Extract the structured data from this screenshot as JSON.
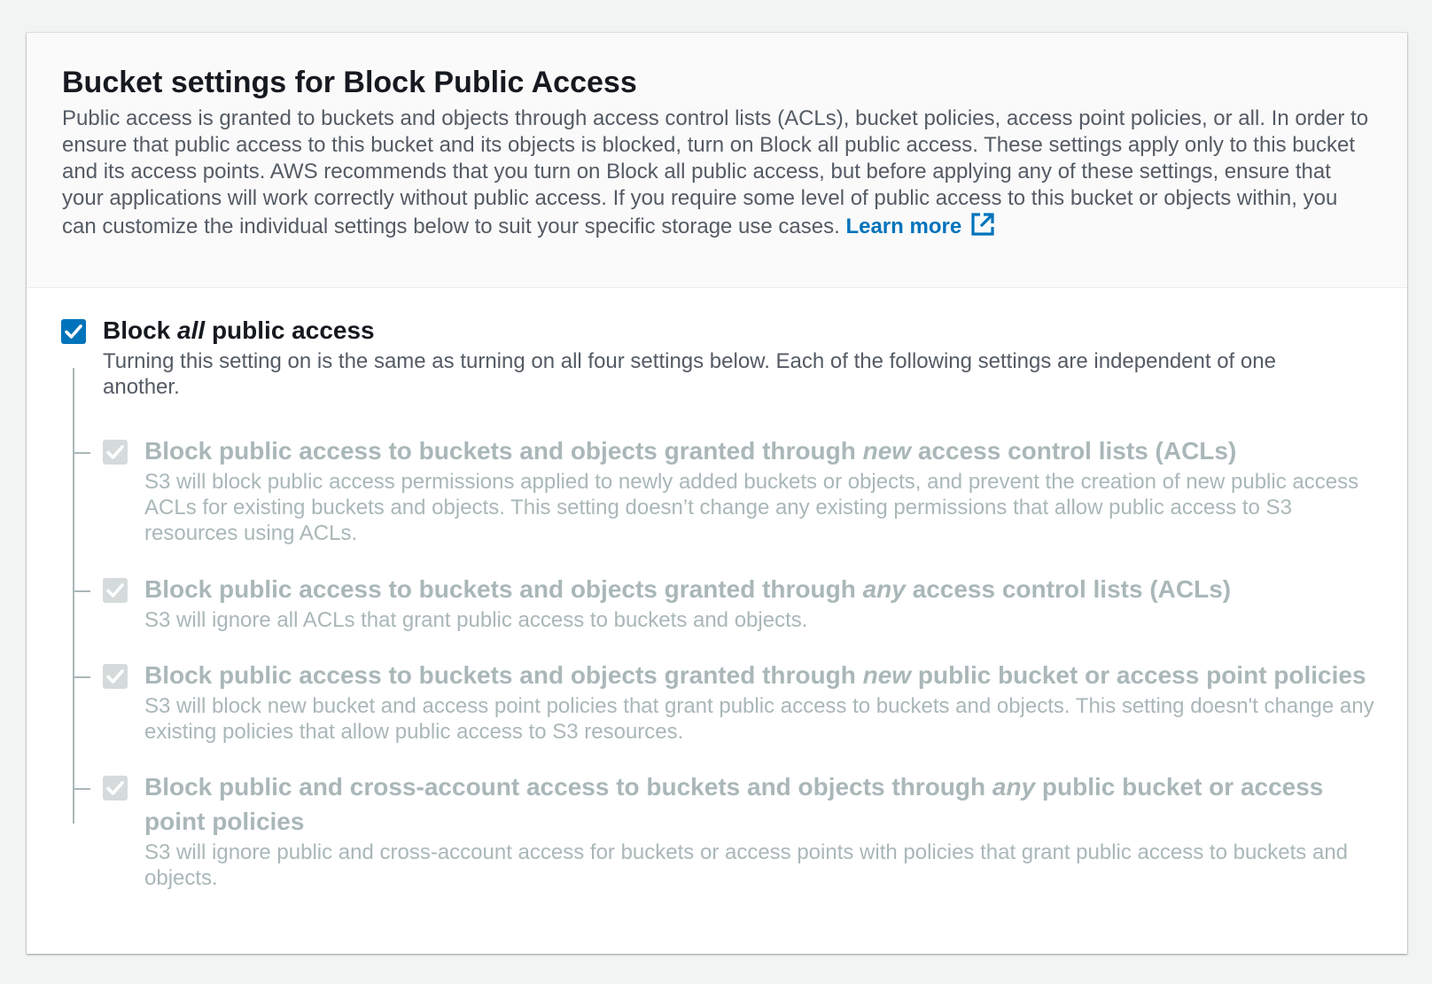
{
  "header": {
    "title": "Bucket settings for Block Public Access",
    "description": "Public access is granted to buckets and objects through access control lists (ACLs), bucket policies, access point policies, or all. In order to ensure that public access to this bucket and its objects is blocked, turn on Block all public access. These settings apply only to this bucket and its access points. AWS recommends that you turn on Block all public access, but before applying any of these settings, ensure that your applications will work correctly without public access. If you require some level of public access to this bucket or objects within, you can customize the individual settings below to suit your specific storage use cases.",
    "learn_more": "Learn more",
    "external_link_icon": "external-link-icon"
  },
  "block_all": {
    "checked": true,
    "label_pre": "Block ",
    "label_em": "all",
    "label_post": " public access",
    "description": "Turning this setting on is the same as turning on all four settings below. Each of the following settings are independent of one another."
  },
  "options": [
    {
      "checked": true,
      "disabled": true,
      "label_pre": "Block public access to buckets and objects granted through ",
      "label_em": "new",
      "label_post": " access control lists (ACLs)",
      "description": "S3 will block public access permissions applied to newly added buckets or objects, and prevent the creation of new public access ACLs for existing buckets and objects. This setting doesn’t change any existing permissions that allow public access to S3 resources using ACLs."
    },
    {
      "checked": true,
      "disabled": true,
      "label_pre": "Block public access to buckets and objects granted through ",
      "label_em": "any",
      "label_post": " access control lists (ACLs)",
      "description": "S3 will ignore all ACLs that grant public access to buckets and objects."
    },
    {
      "checked": true,
      "disabled": true,
      "label_pre": "Block public access to buckets and objects granted through ",
      "label_em": "new",
      "label_post": " public bucket or access point policies",
      "description": "S3 will block new bucket and access point policies that grant public access to buckets and objects. This setting doesn't change any existing policies that allow public access to S3 resources."
    },
    {
      "checked": true,
      "disabled": true,
      "label_pre": "Block public and cross-account access to buckets and objects through ",
      "label_em": "any",
      "label_post": " public bucket or access point policies",
      "description": "S3 will ignore public and cross-account access for buckets or access points with policies that grant public access to buckets and objects."
    }
  ],
  "colors": {
    "accent": "#0073bb",
    "checkbox_disabled": "#d5dbdb",
    "text_disabled": "#aab7b8"
  }
}
